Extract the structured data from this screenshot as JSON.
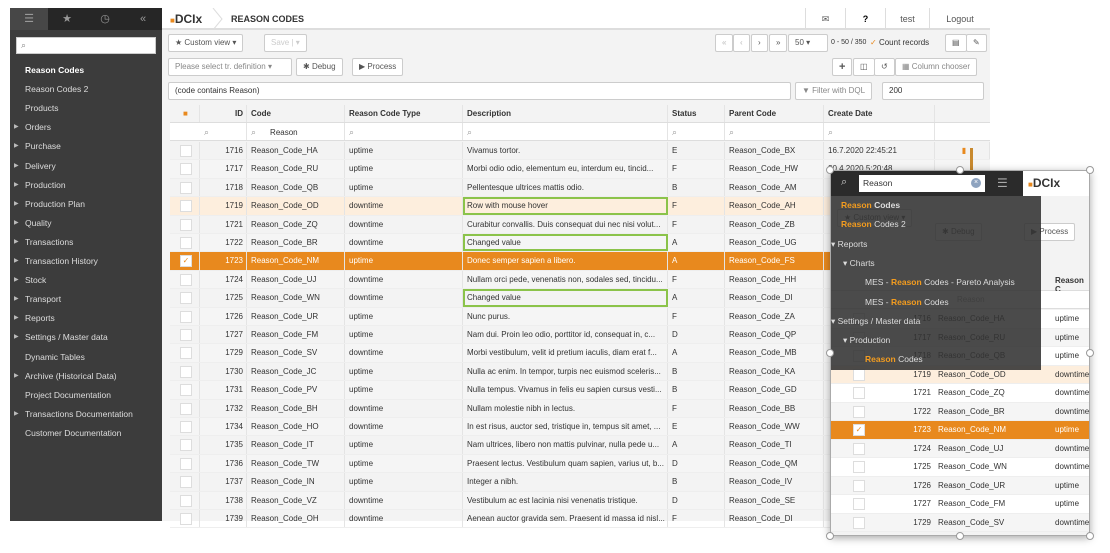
{
  "app": {
    "logo": "DCIx",
    "page_title": "REASON CODES",
    "user": "test",
    "logout": "Logout",
    "accent": "#e8891e"
  },
  "sidebar": {
    "tabs": [
      "menu-icon",
      "star-icon",
      "clock-icon",
      "collapse-icon"
    ],
    "search_placeholder": "",
    "items": [
      {
        "label": "Reason Codes",
        "bold": true,
        "arrow": false
      },
      {
        "label": "Reason Codes 2",
        "arrow": false
      },
      {
        "label": "Products",
        "arrow": false
      },
      {
        "label": "Orders",
        "arrow": true
      },
      {
        "label": "Purchase",
        "arrow": true
      },
      {
        "label": "Delivery",
        "arrow": true
      },
      {
        "label": "Production",
        "arrow": true
      },
      {
        "label": "Production Plan",
        "arrow": true
      },
      {
        "label": "Quality",
        "arrow": true
      },
      {
        "label": "Transactions",
        "arrow": true
      },
      {
        "label": "Transaction History",
        "arrow": true
      },
      {
        "label": "Stock",
        "arrow": true
      },
      {
        "label": "Transport",
        "arrow": true
      },
      {
        "label": "Reports",
        "arrow": true
      },
      {
        "label": "Settings / Master data",
        "arrow": true
      },
      {
        "label": "Dynamic Tables",
        "arrow": false
      },
      {
        "label": "Archive (Historical Data)",
        "arrow": true
      },
      {
        "label": "Project Documentation",
        "arrow": false
      },
      {
        "label": "Transactions Documentation",
        "arrow": true
      },
      {
        "label": "Customer Documentation",
        "arrow": false
      }
    ]
  },
  "toolbar": {
    "custom_view": "Custom view",
    "save": "Save",
    "page_size": "50",
    "range": "0 - 50 / 350",
    "count_records": "Count records",
    "tr_definition": "Please select tr. definition",
    "debug": "Debug",
    "process": "Process",
    "column_chooser": "Column chooser",
    "filter_text": "(code contains Reason)",
    "filter_dql": "Filter with DQL",
    "limit": "200"
  },
  "table": {
    "columns": [
      "ID",
      "Code",
      "Reason Code Type",
      "Description",
      "Status",
      "Parent Code",
      "Create Date"
    ],
    "code_filter": "Reason",
    "rows": [
      {
        "id": "1716",
        "code": "Reason_Code_HA",
        "type": "uptime",
        "desc": "Vivamus tortor.",
        "status": "E",
        "parent": "Reason_Code_BX",
        "date": "16.7.2020 22:45:21"
      },
      {
        "id": "1717",
        "code": "Reason_Code_RU",
        "type": "uptime",
        "desc": "Morbi odio odio, elementum eu, interdum eu, tincid...",
        "status": "F",
        "parent": "Reason_Code_HW",
        "date": "?0.4.2020 5:20:48"
      },
      {
        "id": "1718",
        "code": "Reason_Code_QB",
        "type": "uptime",
        "desc": "Pellentesque ultrices mattis odio.",
        "status": "B",
        "parent": "Reason_Code_AM"
      },
      {
        "id": "1719",
        "code": "Reason_Code_OD",
        "type": "downtime",
        "desc": "Row with mouse hover",
        "status": "F",
        "parent": "Reason_Code_AH",
        "state": "hover",
        "changed": true
      },
      {
        "id": "1721",
        "code": "Reason_Code_ZQ",
        "type": "downtime",
        "desc": "Curabitur convallis. Duis consequat dui nec nisi volut...",
        "status": "F",
        "parent": "Reason_Code_ZB"
      },
      {
        "id": "1722",
        "code": "Reason_Code_BR",
        "type": "downtime",
        "desc": "Changed value",
        "status": "A",
        "parent": "Reason_Code_UG",
        "changed": true
      },
      {
        "id": "1723",
        "code": "Reason_Code_NM",
        "type": "uptime",
        "desc": "Donec semper sapien a libero.",
        "status": "A",
        "parent": "Reason_Code_FS",
        "state": "selected"
      },
      {
        "id": "1724",
        "code": "Reason_Code_UJ",
        "type": "downtime",
        "desc": "Nullam orci pede, venenatis non, sodales sed, tincidu...",
        "status": "F",
        "parent": "Reason_Code_HH"
      },
      {
        "id": "1725",
        "code": "Reason_Code_WN",
        "type": "downtime",
        "desc": "Changed value",
        "status": "A",
        "parent": "Reason_Code_DI",
        "changed": true
      },
      {
        "id": "1726",
        "code": "Reason_Code_UR",
        "type": "uptime",
        "desc": "Nunc purus.",
        "status": "F",
        "parent": "Reason_Code_ZA"
      },
      {
        "id": "1727",
        "code": "Reason_Code_FM",
        "type": "uptime",
        "desc": "Nam dui. Proin leo odio, porttitor id, consequat in, c...",
        "status": "D",
        "parent": "Reason_Code_QP"
      },
      {
        "id": "1729",
        "code": "Reason_Code_SV",
        "type": "downtime",
        "desc": "Morbi vestibulum, velit id pretium iaculis, diam erat f...",
        "status": "A",
        "parent": "Reason_Code_MB"
      },
      {
        "id": "1730",
        "code": "Reason_Code_JC",
        "type": "uptime",
        "desc": "Nulla ac enim. In tempor, turpis nec euismod sceleris...",
        "status": "B",
        "parent": "Reason_Code_KA"
      },
      {
        "id": "1731",
        "code": "Reason_Code_PV",
        "type": "uptime",
        "desc": "Nulla tempus. Vivamus in felis eu sapien cursus vesti...",
        "status": "B",
        "parent": "Reason_Code_GD"
      },
      {
        "id": "1732",
        "code": "Reason_Code_BH",
        "type": "downtime",
        "desc": "Nullam molestie nibh in lectus.",
        "status": "F",
        "parent": "Reason_Code_BB"
      },
      {
        "id": "1734",
        "code": "Reason_Code_HO",
        "type": "downtime",
        "desc": "In est risus, auctor sed, tristique in, tempus sit amet, ...",
        "status": "E",
        "parent": "Reason_Code_WW"
      },
      {
        "id": "1735",
        "code": "Reason_Code_IT",
        "type": "uptime",
        "desc": "Nam ultrices, libero non mattis pulvinar, nulla pede u...",
        "status": "A",
        "parent": "Reason_Code_TI"
      },
      {
        "id": "1736",
        "code": "Reason_Code_TW",
        "type": "uptime",
        "desc": "Praesent lectus. Vestibulum quam sapien, varius ut, b...",
        "status": "D",
        "parent": "Reason_Code_QM"
      },
      {
        "id": "1737",
        "code": "Reason_Code_IN",
        "type": "uptime",
        "desc": "Integer a nibh.",
        "status": "B",
        "parent": "Reason_Code_IV"
      },
      {
        "id": "1738",
        "code": "Reason_Code_VZ",
        "type": "downtime",
        "desc": "Vestibulum ac est lacinia nisi venenatis tristique.",
        "status": "D",
        "parent": "Reason_Code_SE"
      },
      {
        "id": "1739",
        "code": "Reason_Code_OH",
        "type": "downtime",
        "desc": "Aenean auctor gravida sem. Praesent id massa id nisl...",
        "status": "F",
        "parent": "Reason_Code_DI"
      }
    ]
  },
  "mobile": {
    "search_value": "Reason",
    "header_col": "Reason C",
    "menu": [
      {
        "pre": "",
        "hl": "Reason",
        "post": " Codes",
        "indent": 0,
        "arrow": false,
        "bold": true
      },
      {
        "pre": "",
        "hl": "Reason",
        "post": " Codes 2",
        "indent": 0,
        "arrow": false
      },
      {
        "pre": "Reports",
        "hl": "",
        "post": "",
        "indent": 0,
        "arrow": true
      },
      {
        "pre": "Charts",
        "hl": "",
        "post": "",
        "indent": 1,
        "arrow": true
      },
      {
        "pre": "MES - ",
        "hl": "Reason",
        "post": " Codes - Pareto Analysis",
        "indent": 2,
        "arrow": false
      },
      {
        "pre": "MES - ",
        "hl": "Reason",
        "post": " Codes",
        "indent": 2,
        "arrow": false
      },
      {
        "pre": "Settings / Master data",
        "hl": "",
        "post": "",
        "indent": 0,
        "arrow": true
      },
      {
        "pre": "Production",
        "hl": "",
        "post": "",
        "indent": 1,
        "arrow": true
      },
      {
        "pre": "",
        "hl": "Reason",
        "post": " Codes",
        "indent": 2,
        "arrow": false
      }
    ]
  }
}
